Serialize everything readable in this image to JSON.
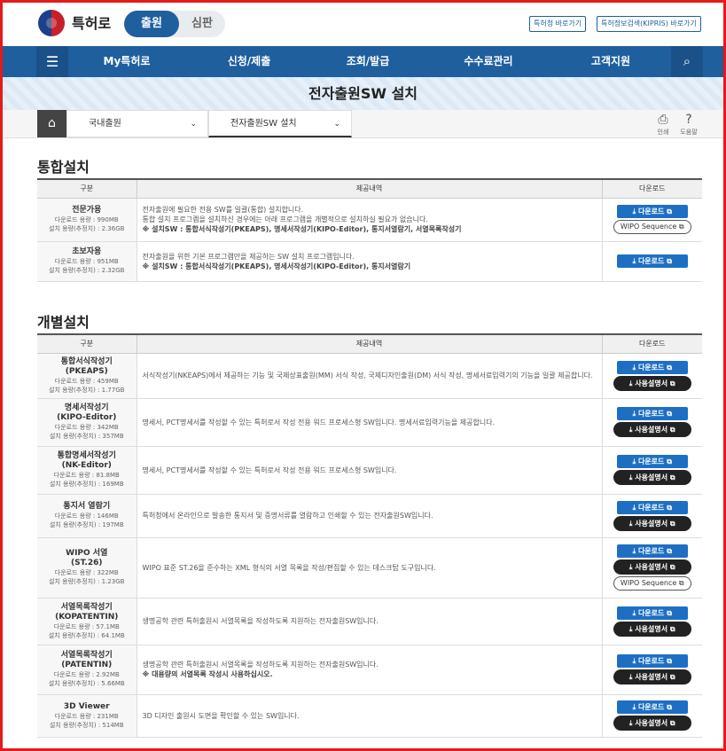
{
  "header": {
    "brand": "특허로",
    "seg_on": "출원",
    "seg_off": "심판",
    "link1": "특허청 바로가기",
    "link2": "특허정보검색(KIPRIS) 바로가기"
  },
  "nav": {
    "items": [
      "My특허로",
      "신청/제출",
      "조회/발급",
      "수수료관리",
      "고객지원"
    ]
  },
  "page_title": "전자출원SW 설치",
  "breadcrumb": {
    "level1": "국내출원",
    "level2": "전자출원SW 설치",
    "print": "인쇄",
    "help": "도움말"
  },
  "icons": {
    "menu": "☰",
    "search": "⌕",
    "home": "⌂",
    "chevron": "⌄",
    "print": "⎙",
    "help": "?",
    "download": "⤓",
    "external": "⧉"
  },
  "colors": {
    "primary": "#1f5f9e",
    "button": "#1e6fc4",
    "frame": "#e31b1b"
  },
  "table_headers": {
    "col1": "구분",
    "col2": "제공내역",
    "col3": "다운로드"
  },
  "buttons": {
    "download": "다운로드",
    "manual": "사용설명서",
    "wipo": "WIPO Sequence"
  },
  "integrated": {
    "title": "통합설치",
    "rows": [
      {
        "name": "전문가용",
        "dl": "다운로드 용량 : 990MB",
        "inst": "설치 용량(추정치) : 2.36GB",
        "desc": [
          "전자출원에 필요한 전용 SW를 일괄(통합) 설치합니다.",
          "통합 설치 프로그램을 설치하신 경우에는 아래 프로그램을 개별적으로 설치하실 필요가 없습니다."
        ],
        "note": "※ 설치SW : 통합서식작성기(PKEAPS), 명세서작성기(KIPO-Editor), 통지서열람기, 서열목록작성기"
      },
      {
        "name": "초보자용",
        "dl": "다운로드 용량 : 951MB",
        "inst": "설치 용량(추정치) : 2.32GB",
        "desc": [
          "전자출원을 위한 기본 프로그램만을 제공하는 SW 설치 프로그램입니다."
        ],
        "note": "※ 설치SW : 통합서식작성기(PKEAPS), 명세서작성기(KIPO-Editor), 통지서열람기"
      }
    ]
  },
  "individual": {
    "title": "개별설치",
    "rows": [
      {
        "name": "통합서식작성기",
        "sub": "(PKEAPS)",
        "dl": "다운로드 용량 : 459MB",
        "inst": "설치 용량(추정치) : 1.77GB",
        "desc": "서식작성기(NKEAPS)에서 제공하는 기능 및 국제상표출원(MM) 서식 작성, 국제디자인출원(DM) 서식 작성, 명세서료입력기의 기능을 일괄 제공합니다."
      },
      {
        "name": "명세서작성기",
        "sub": "(KIPO-Editor)",
        "dl": "다운로드 용량 : 342MB",
        "inst": "설치 용량(추정치) : 357MB",
        "desc": "명세서, PCT명세서를 작성할 수 있는 특허로서 작성 전용 워드 프로세스형 SW입니다. 명세서료입력기능을 제공합니다."
      },
      {
        "name": "통합명세서작성기",
        "sub": "(NK-Editor)",
        "dl": "다운로드 용량 : 81.8MB",
        "inst": "설치 용량(추정치) : 169MB",
        "desc": "명세서, PCT명세서를 작성할 수 있는 특허로서 작성 전용 워드 프로세스형 SW입니다."
      },
      {
        "name": "통지서 열람기",
        "sub": "",
        "dl": "다운로드 용량 : 146MB",
        "inst": "설치 용량(추정치) : 197MB",
        "desc": "특허청에서 온라인으로 발송한 통지서 및 증명서류를 열람하고 인쇄할 수 있는 전자출원SW입니다."
      },
      {
        "name": "WIPO 서열",
        "sub": "(ST.26)",
        "dl": "다운로드 용량 : 322MB",
        "inst": "설치 용량(추정치) : 1.23GB",
        "desc": "WIPO 표준 ST.26을 준수하는 XML 형식의 서열 목록을 작성/편집할 수 있는 데스크탑 도구입니다."
      },
      {
        "name": "서열목록작성기",
        "sub": "(KOPATENTIN)",
        "dl": "다운로드 용량 : 57.1MB",
        "inst": "설치 용량(추정치) : 64.1MB",
        "desc": "생명공학 관련 특허출원시 서열목록을 작성하도록 지원하는 전자출원SW입니다."
      },
      {
        "name": "서열목록작성기",
        "sub": "(PATENTIN)",
        "dl": "다운로드 용량 : 2.92MB",
        "inst": "설치 용량(추정치) : 5.66MB",
        "desc": "생명공학 관련 특허출원시 서열목록을 작성하도록 지원하는 전자출원SW입니다.",
        "note": "※ 대용량의 서열목록 작성시 사용하십시오."
      },
      {
        "name": "3D Viewer",
        "sub": "",
        "dl": "다운로드 용량 : 231MB",
        "inst": "설치 용량(추정치) : 514MB",
        "desc": "3D 디자인 출원시 도면을 확인할 수 있는 SW입니다."
      }
    ]
  }
}
